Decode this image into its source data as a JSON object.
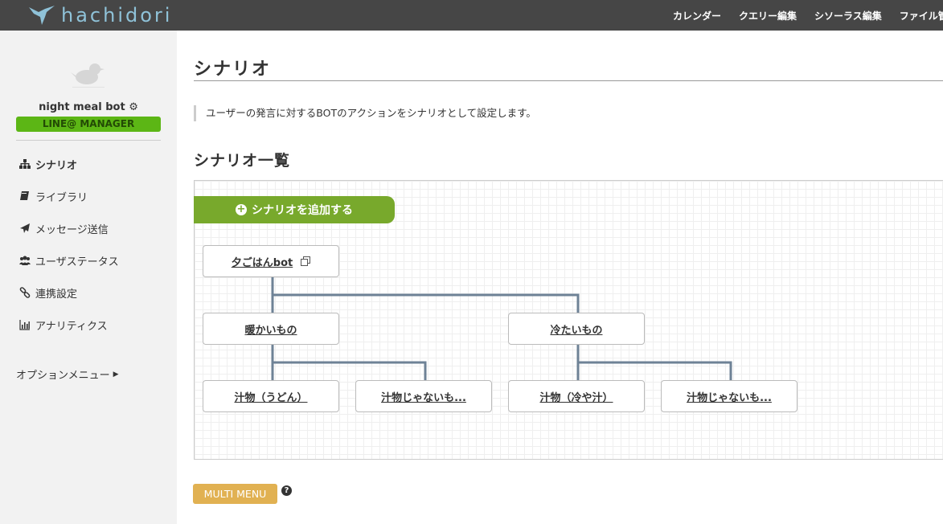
{
  "app": {
    "logo_text": "hachidori"
  },
  "topnav": [
    "カレンダー",
    "クエリー編集",
    "シソーラス編集",
    "ファイル管"
  ],
  "sidebar": {
    "bot_name": "night meal bot",
    "badge": "LINE@ MANAGER",
    "items": [
      {
        "label": "シナリオ",
        "icon": "sitemap-icon",
        "active": true
      },
      {
        "label": "ライブラリ",
        "icon": "book-icon",
        "active": false
      },
      {
        "label": "メッセージ送信",
        "icon": "paper-plane-icon",
        "active": false
      },
      {
        "label": "ユーザステータス",
        "icon": "users-icon",
        "active": false
      },
      {
        "label": "連携設定",
        "icon": "link-icon",
        "active": false
      },
      {
        "label": "アナリティクス",
        "icon": "bar-chart-icon",
        "active": false
      }
    ],
    "option_menu": "オプションメニュー"
  },
  "main": {
    "title": "シナリオ",
    "description": "ユーザーの発言に対するBOTのアクションをシナリオとして設定します。",
    "section_title": "シナリオ一覧",
    "add_button": "シナリオを追加する",
    "tree": {
      "root": "夕ごはんbot",
      "level1": [
        "暖かいもの",
        "冷たいもの"
      ],
      "level2": [
        "汁物（うどん）",
        "汁物じゃないも...",
        "汁物（冷や汁）",
        "汁物じゃないも..."
      ]
    },
    "multi_menu": "MULTI MENU"
  },
  "colors": {
    "topbar": "#464646",
    "accent_green": "#78a92c",
    "badge_green": "#5cb615",
    "multi_menu": "#e1b152",
    "tree_line": "#6e8296"
  }
}
